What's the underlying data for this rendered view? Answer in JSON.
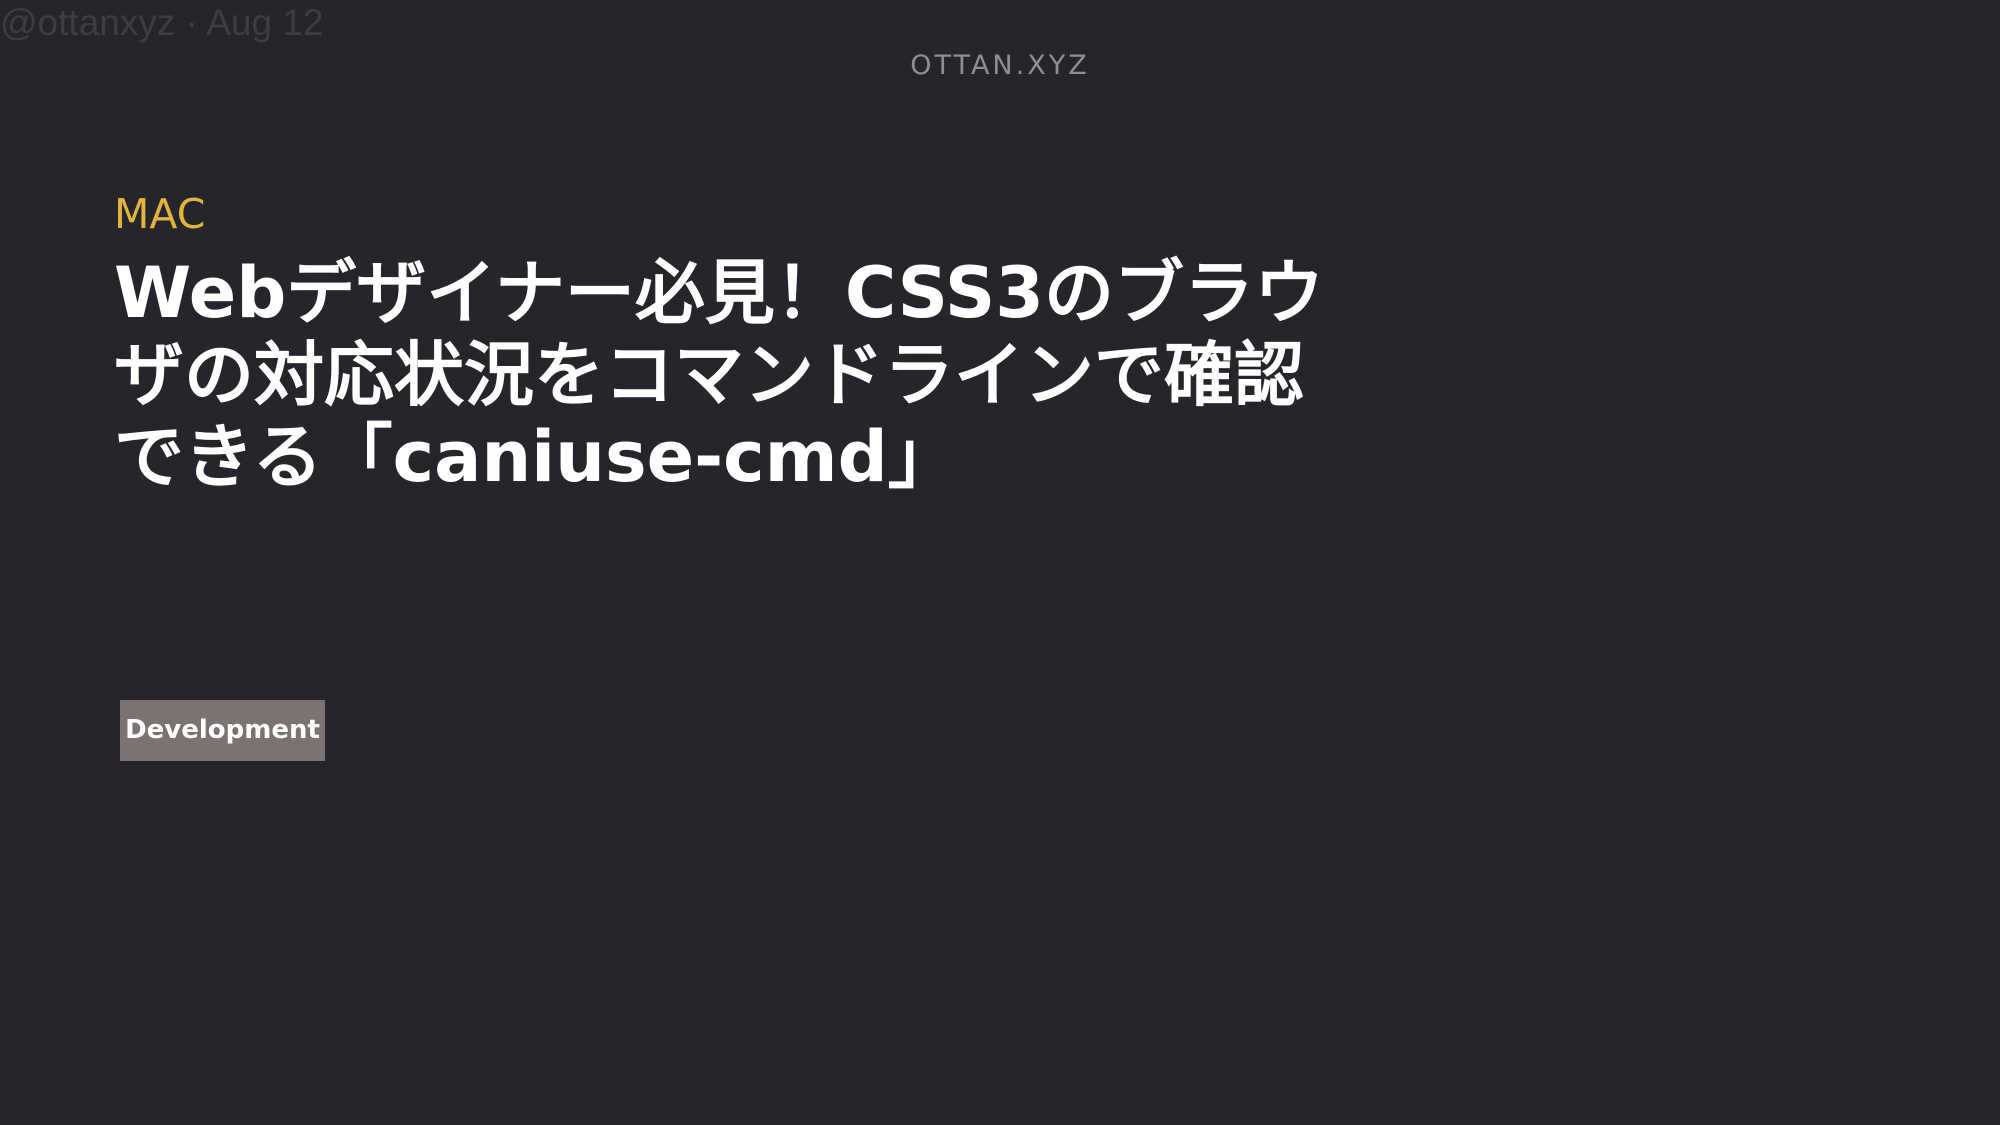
{
  "header": {
    "byline": "@ottanxyz · Aug 12",
    "site_name": "OTTAN.XYZ"
  },
  "article": {
    "category": "MAC",
    "title": "Webデザイナー必見！CSS3のブラウザの対応状況をコマンドラインで確認できる「caniuse-cmd」",
    "tags": [
      "Development"
    ]
  },
  "colors": {
    "background": "#25262b",
    "category": "#e4b43a",
    "title": "#ffffff",
    "tag_background": "#7a7372"
  }
}
